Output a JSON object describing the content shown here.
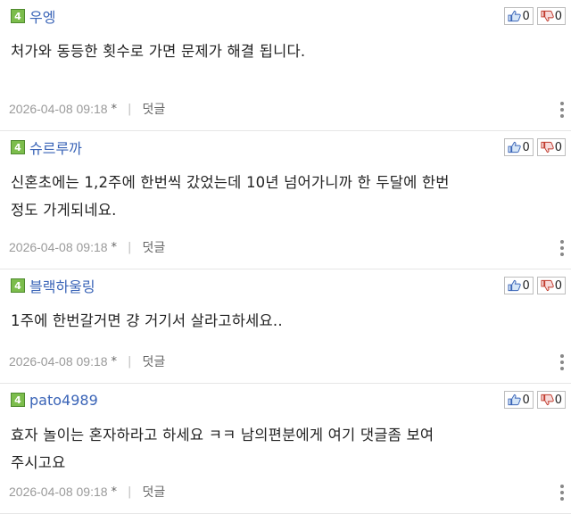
{
  "colors": {
    "nick": "#3a64b7",
    "level_badge": "#7cbd4c",
    "meta": "#9a9a9a"
  },
  "comments": [
    {
      "level": "4",
      "nick": "우엥",
      "up": "0",
      "down": "0",
      "lines": [
        "처가와 동등한 횟수로 가면 문제가 해결 됩니다."
      ],
      "date": "2026-04-08 09:18",
      "star": "*",
      "reply": "덧글"
    },
    {
      "level": "4",
      "nick": "슈르루까",
      "up": "0",
      "down": "0",
      "lines": [
        "신혼초에는 1,2주에 한번씩 갔었는데 10년 넘어가니까 한 두달에 한번",
        "정도 가게되네요."
      ],
      "date": "2026-04-08 09:18",
      "star": "*",
      "reply": "덧글"
    },
    {
      "level": "4",
      "nick": "블랙하울링",
      "up": "0",
      "down": "0",
      "lines": [
        "1주에 한번갈거면 걍 거기서 살라고하세요.."
      ],
      "date": "2026-04-08 09:18",
      "star": "*",
      "reply": "덧글"
    },
    {
      "level": "4",
      "nick": "pato4989",
      "up": "0",
      "down": "0",
      "lines": [
        "효자 놀이는 혼자하라고 하세요 ㅋㅋ 남의편분에게 여기 댓글좀 보여",
        "주시고요"
      ],
      "date": "2026-04-08 09:18",
      "star": "*",
      "reply": "덧글"
    }
  ]
}
